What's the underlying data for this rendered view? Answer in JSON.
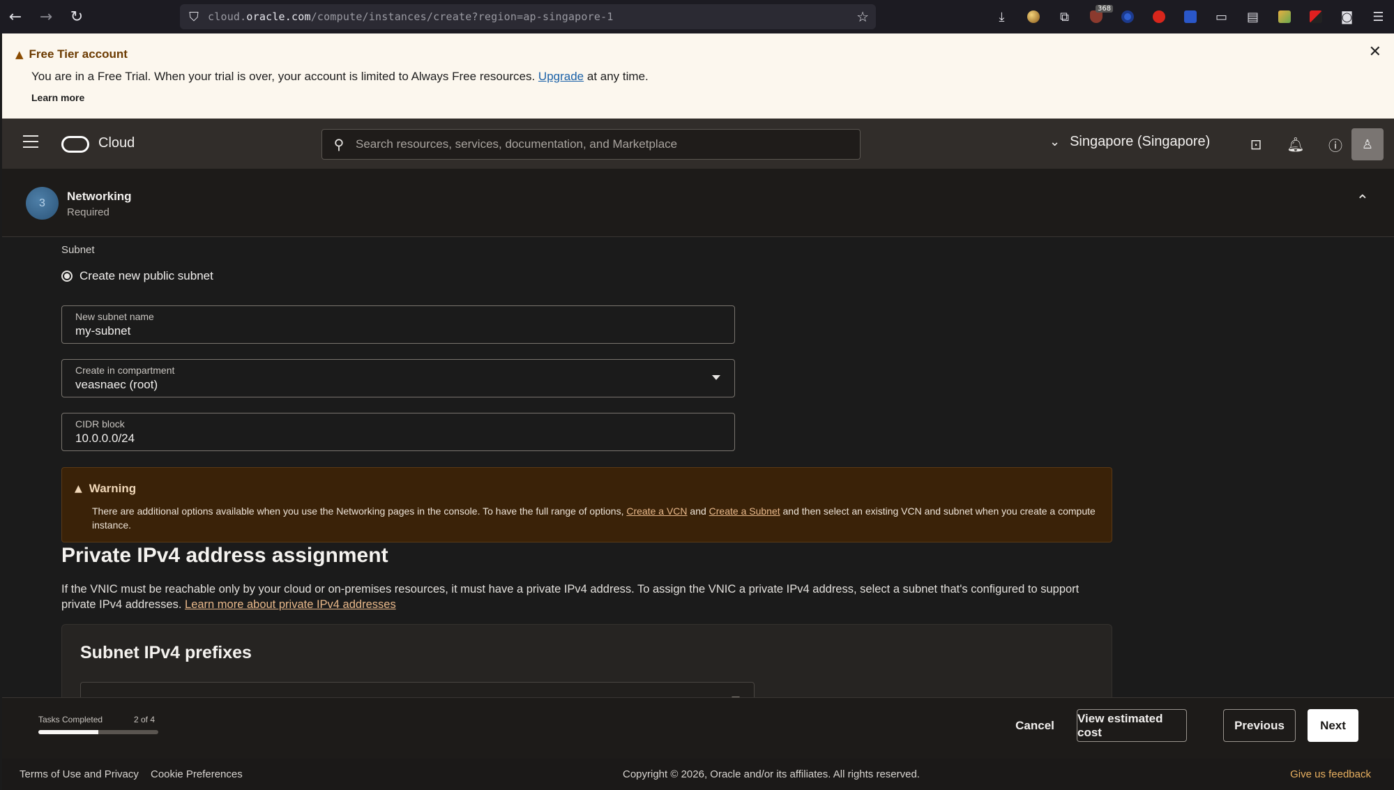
{
  "browser": {
    "url_prefix": "cloud.",
    "url_host": "oracle.com",
    "url_path": "/compute/instances/create?region=ap-singapore-1",
    "ext_badge": "368"
  },
  "banner": {
    "title": "Free Tier account",
    "text_before": "You are in a Free Trial. When your trial is over, your account is limited to Always Free resources.",
    "upgrade_link": "Upgrade",
    "text_after": "at any time.",
    "learn_more": "Learn more"
  },
  "header": {
    "logo_text": "Cloud",
    "search_placeholder": "Search resources, services, documentation, and Marketplace",
    "region": "Singapore (Singapore)"
  },
  "section": {
    "step_number": "3",
    "title": "Networking",
    "subtitle": "Required"
  },
  "form": {
    "subnet_label": "Subnet",
    "radio_label": "Create new public subnet",
    "subnet_name": {
      "label": "New subnet name",
      "value": "my-subnet"
    },
    "compartment": {
      "label": "Create in compartment",
      "value": "veasnaec (root)"
    },
    "cidr": {
      "label": "CIDR block",
      "value": "10.0.0.0/24"
    }
  },
  "warning": {
    "title": "Warning",
    "text_1": "There are additional options available when you use the Networking pages in the console. To have the full range of options,",
    "link_vcn": "Create a VCN",
    "text_and": "and",
    "link_subnet": "Create a Subnet",
    "text_2": "and then select an existing VCN and subnet when you create a compute instance."
  },
  "private_ipv4": {
    "heading": "Private IPv4 address assignment",
    "paragraph": "If the VNIC must be reachable only by your cloud or on-premises resources, it must have a private IPv4 address. To assign the VNIC a private IPv4 address, select a subnet that's configured to support private IPv4 addresses.",
    "link": "Learn more about private IPv4 addresses"
  },
  "prefixes": {
    "heading": "Subnet IPv4 prefixes"
  },
  "footer_bar": {
    "tasks_label": "Tasks Completed",
    "tasks_count": "2 of 4",
    "progress_fraction": 0.5,
    "cancel": "Cancel",
    "view_cost": "View estimated cost",
    "previous": "Previous",
    "next": "Next"
  },
  "page_footer": {
    "terms": "Terms of Use and Privacy",
    "cookies": "Cookie Preferences",
    "copyright": "Copyright © 2026, Oracle and/or its affiliates. All rights reserved.",
    "feedback": "Give us feedback"
  }
}
